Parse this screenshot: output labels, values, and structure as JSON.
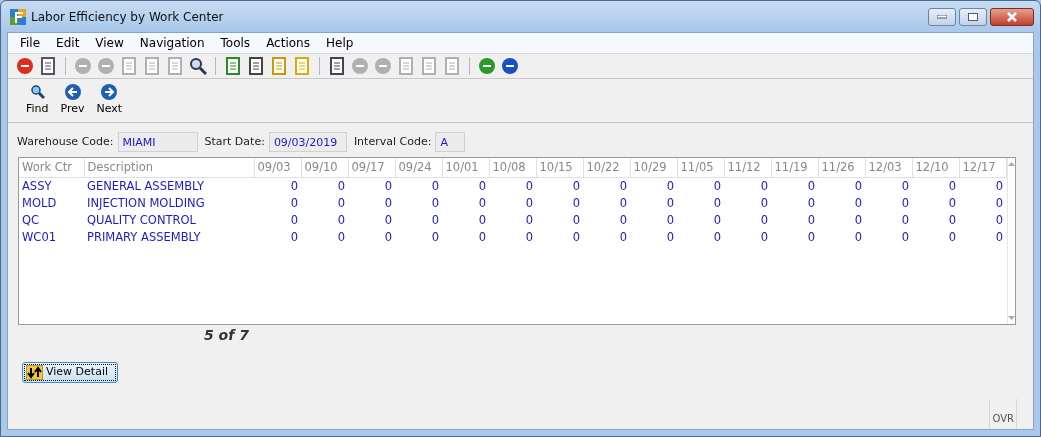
{
  "window": {
    "title": "Labor Efficiency by Work Center"
  },
  "menu": [
    "File",
    "Edit",
    "View",
    "Navigation",
    "Tools",
    "Actions",
    "Help"
  ],
  "toolbar": [
    {
      "disabled": false
    },
    {
      "disabled": false
    },
    {
      "disabled": true
    },
    {
      "disabled": true
    },
    {
      "disabled": true
    },
    {
      "disabled": true
    },
    {
      "disabled": true
    },
    {
      "disabled": false
    },
    {
      "disabled": false
    },
    {
      "disabled": false
    },
    {
      "disabled": false
    },
    {
      "disabled": false
    },
    {
      "disabled": false
    },
    {
      "disabled": true
    },
    {
      "disabled": true
    },
    {
      "disabled": true
    },
    {
      "disabled": true
    },
    {
      "disabled": true
    },
    {
      "disabled": false
    },
    {
      "disabled": false
    }
  ],
  "nav_buttons": [
    "Find",
    "Prev",
    "Next"
  ],
  "fields": [
    {
      "label": "Warehouse Code:",
      "value": "MIAMI"
    },
    {
      "label": "Start Date:",
      "value": "09/03/2019"
    },
    {
      "label": "Interval Code:",
      "value": "A"
    }
  ],
  "table": {
    "columns": [
      "Work Ctr",
      "Description",
      "09/03",
      "09/10",
      "09/17",
      "09/24",
      "10/01",
      "10/08",
      "10/15",
      "10/22",
      "10/29",
      "11/05",
      "11/12",
      "11/19",
      "11/26",
      "12/03",
      "12/10",
      "12/17"
    ],
    "rows": [
      [
        "ASSY",
        "GENERAL ASSEMBLY",
        "0",
        "0",
        "0",
        "0",
        "0",
        "0",
        "0",
        "0",
        "0",
        "0",
        "0",
        "0",
        "0",
        "0",
        "0",
        "0"
      ],
      [
        "MOLD",
        "INJECTION MOLDING",
        "0",
        "0",
        "0",
        "0",
        "0",
        "0",
        "0",
        "0",
        "0",
        "0",
        "0",
        "0",
        "0",
        "0",
        "0",
        "0"
      ],
      [
        "QC",
        "QUALITY CONTROL",
        "0",
        "0",
        "0",
        "0",
        "0",
        "0",
        "0",
        "0",
        "0",
        "0",
        "0",
        "0",
        "0",
        "0",
        "0",
        "0"
      ],
      [
        "WC01",
        "PRIMARY ASSEMBLY",
        "0",
        "0",
        "0",
        "0",
        "0",
        "0",
        "0",
        "0",
        "0",
        "0",
        "0",
        "0",
        "0",
        "0",
        "0",
        "0"
      ]
    ]
  },
  "record_counter": "5 of 7",
  "detail_button": "View Detail",
  "status_bar": {
    "mode": "OVR"
  }
}
